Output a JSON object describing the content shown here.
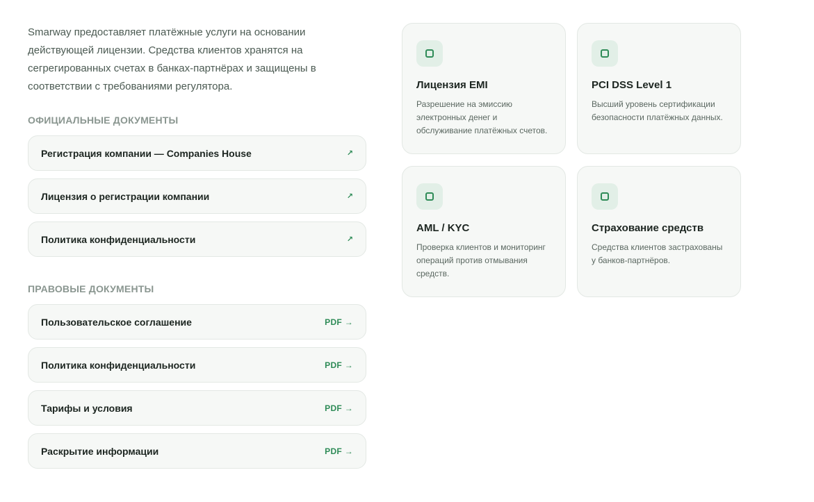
{
  "intro": "Smarway предоставляет платёжные услуги на основании действующей лицензии. Средства клиентов хранятся на сегрегированных счетах в банках-партнёрах и защищены в соответствии с требованиями регулятора.",
  "official": {
    "title": "ОФИЦИАЛЬНЫЕ ДОКУМЕНТЫ",
    "items": [
      {
        "label": "Регистрация компании — Companies House",
        "icon": "external-link-arrow",
        "glyph": "↗"
      },
      {
        "label": "Лицензия о регистрации компании",
        "icon": "external-link-arrow",
        "glyph": "↗"
      },
      {
        "label": "Политика конфиденциальности",
        "icon": "external-link-arrow",
        "glyph": "↗"
      }
    ]
  },
  "legal": {
    "title": "ПРАВОВЫЕ ДОКУМЕНТЫ",
    "items": [
      {
        "label": "Пользовательское соглашение",
        "action": "PDF →"
      },
      {
        "label": "Политика конфиденциальности",
        "action": "PDF →"
      },
      {
        "label": "Тарифы и условия",
        "action": "PDF →"
      },
      {
        "label": "Раскрытие информации",
        "action": "PDF →"
      }
    ]
  },
  "cards": [
    {
      "title": "Лицензия EMI",
      "desc": "Разрешение на эмиссию электронных денег и обслуживание платёжных счетов.",
      "icon": "square-icon"
    },
    {
      "title": "PCI DSS Level 1",
      "desc": "Высший уровень сертификации безопасности платёжных данных.",
      "icon": "square-icon"
    },
    {
      "title": "AML / KYC",
      "desc": "Проверка клиентов и мониторинг операций против отмывания средств.",
      "icon": "square-icon"
    },
    {
      "title": "Страхование средств",
      "desc": "Средства клиентов застрахованы у банков-партнёров.",
      "icon": "square-icon"
    }
  ],
  "colors": {
    "accent": "#2e8b57",
    "card_bg": "#f6f8f6",
    "border": "#e3e8e4",
    "section_title": "#8a9690"
  }
}
